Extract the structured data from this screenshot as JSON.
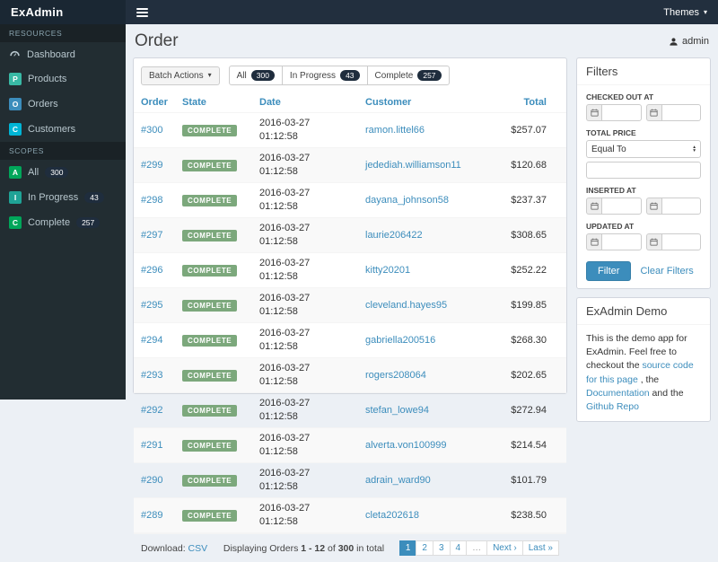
{
  "colors": {
    "accent_blue": "#3c8dbc",
    "navy": "#1f2d3d",
    "status_complete_green": "#7ca87c",
    "badge_teal": "#39b9a5",
    "badge_green": "#00a65a",
    "badge_cyan": "#00b5d6",
    "sidebar_bg": "#222d32",
    "content_bg": "#ecf0f5"
  },
  "topbar": {
    "brand": "ExAdmin",
    "themes_label": "Themes"
  },
  "user": {
    "name": "admin"
  },
  "sidebar": {
    "resources_header": "RESOURCES",
    "scopes_header": "SCOPES",
    "resources": [
      {
        "label": "Dashboard"
      },
      {
        "label": "Products",
        "abbr": "P"
      },
      {
        "label": "Orders",
        "abbr": "O"
      },
      {
        "label": "Customers",
        "abbr": "C"
      }
    ],
    "scopes": [
      {
        "label": "All",
        "abbr": "A",
        "count": "300"
      },
      {
        "label": "In Progress",
        "abbr": "I",
        "count": "43"
      },
      {
        "label": "Complete",
        "abbr": "C",
        "count": "257"
      }
    ]
  },
  "page": {
    "title": "Order"
  },
  "toolbar": {
    "batch_actions_label": "Batch Actions",
    "scope_tabs": [
      {
        "label": "All",
        "count": "300"
      },
      {
        "label": "In Progress",
        "count": "43"
      },
      {
        "label": "Complete",
        "count": "257"
      }
    ]
  },
  "table": {
    "headers": [
      "Order",
      "State",
      "Date",
      "Customer",
      "Total"
    ],
    "rows": [
      {
        "order": "#300",
        "state": "COMPLETE",
        "date": "2016-03-27 01:12:58",
        "customer": "ramon.littel66",
        "total": "$257.07"
      },
      {
        "order": "#299",
        "state": "COMPLETE",
        "date": "2016-03-27 01:12:58",
        "customer": "jedediah.williamson11",
        "total": "$120.68"
      },
      {
        "order": "#298",
        "state": "COMPLETE",
        "date": "2016-03-27 01:12:58",
        "customer": "dayana_johnson58",
        "total": "$237.37"
      },
      {
        "order": "#297",
        "state": "COMPLETE",
        "date": "2016-03-27 01:12:58",
        "customer": "laurie206422",
        "total": "$308.65"
      },
      {
        "order": "#296",
        "state": "COMPLETE",
        "date": "2016-03-27 01:12:58",
        "customer": "kitty20201",
        "total": "$252.22"
      },
      {
        "order": "#295",
        "state": "COMPLETE",
        "date": "2016-03-27 01:12:58",
        "customer": "cleveland.hayes95",
        "total": "$199.85"
      },
      {
        "order": "#294",
        "state": "COMPLETE",
        "date": "2016-03-27 01:12:58",
        "customer": "gabriella200516",
        "total": "$268.30"
      },
      {
        "order": "#293",
        "state": "COMPLETE",
        "date": "2016-03-27 01:12:58",
        "customer": "rogers208064",
        "total": "$202.65"
      },
      {
        "order": "#292",
        "state": "COMPLETE",
        "date": "2016-03-27 01:12:58",
        "customer": "stefan_lowe94",
        "total": "$272.94"
      },
      {
        "order": "#291",
        "state": "COMPLETE",
        "date": "2016-03-27 01:12:58",
        "customer": "alverta.von100999",
        "total": "$214.54"
      },
      {
        "order": "#290",
        "state": "COMPLETE",
        "date": "2016-03-27 01:12:58",
        "customer": "adrain_ward90",
        "total": "$101.79"
      },
      {
        "order": "#289",
        "state": "COMPLETE",
        "date": "2016-03-27 01:12:58",
        "customer": "cleta202618",
        "total": "$238.50"
      }
    ]
  },
  "footer": {
    "download_label": "Download:",
    "download_format": "CSV",
    "displaying": {
      "prefix": "Displaying Orders ",
      "range": "1 - 12",
      "of": " of ",
      "total": "300",
      "suffix": " in total"
    },
    "pagination": [
      {
        "label": "1",
        "active": true
      },
      {
        "label": "2"
      },
      {
        "label": "3"
      },
      {
        "label": "4"
      },
      {
        "label": "…",
        "gap": true
      },
      {
        "label": "Next ›"
      },
      {
        "label": "Last »"
      }
    ]
  },
  "filters": {
    "title": "Filters",
    "checked_out_at_label": "CHECKED OUT AT",
    "total_price_label": "TOTAL PRICE",
    "total_price_operator": "Equal To",
    "inserted_at_label": "INSERTED AT",
    "updated_at_label": "UPDATED AT",
    "filter_button": "Filter",
    "clear_button": "Clear Filters"
  },
  "demo": {
    "title": "ExAdmin Demo",
    "text_parts": [
      {
        "text": "This is the demo app for ExAdmin. Feel free to checkout the "
      },
      {
        "text": "source code for this page",
        "link": true
      },
      {
        "text": " , the "
      },
      {
        "text": "Documentation",
        "link": true
      },
      {
        "text": " and the "
      },
      {
        "text": "Github Repo",
        "link": true
      }
    ]
  }
}
